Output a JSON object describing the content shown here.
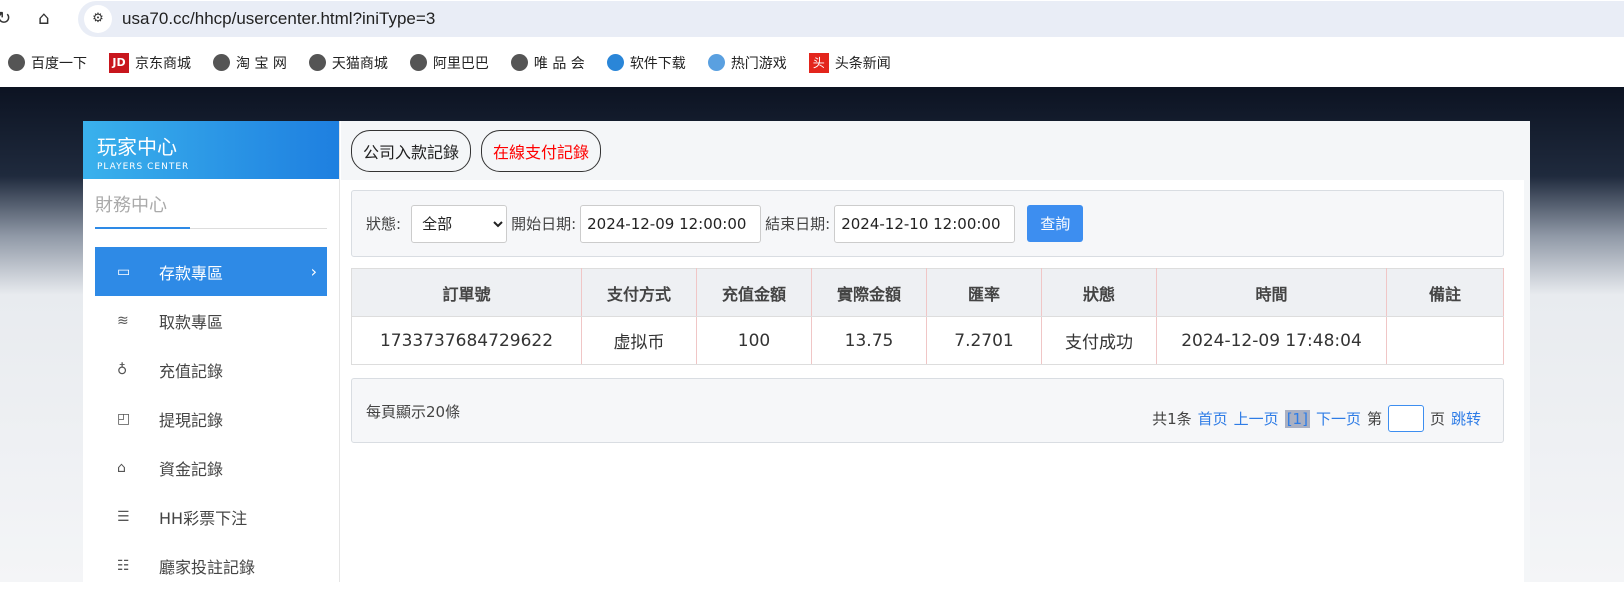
{
  "browser": {
    "url": "usa70.cc/hhcp/usercenter.html?iniType=3",
    "bookmarks": [
      {
        "label": "百度一下",
        "icon": "globe-icon"
      },
      {
        "label": "京东商城",
        "icon": "jd-icon"
      },
      {
        "label": "淘 宝 网",
        "icon": "globe-icon"
      },
      {
        "label": "天猫商城",
        "icon": "globe-icon"
      },
      {
        "label": "阿里巴巴",
        "icon": "globe-icon"
      },
      {
        "label": "唯 品 会",
        "icon": "globe-icon"
      },
      {
        "label": "软件下载",
        "icon": "download-icon"
      },
      {
        "label": "热门游戏",
        "icon": "game-icon"
      },
      {
        "label": "头条新闻",
        "icon": "toutiao-icon"
      }
    ]
  },
  "logo": {
    "title": "玩家中心",
    "subtitle": "PLAYERS CENTER",
    "jd_text": "JD",
    "tt_text": "头"
  },
  "sidebar": {
    "section": "財務中心",
    "items": [
      {
        "label": "存款專區",
        "active": true
      },
      {
        "label": "取款專區"
      },
      {
        "label": "充值記錄"
      },
      {
        "label": "提現記錄"
      },
      {
        "label": "資金記錄"
      },
      {
        "label": "HH彩票下注"
      },
      {
        "label": "廳家投註記錄"
      }
    ]
  },
  "tabs": [
    {
      "label": "公司入款記錄"
    },
    {
      "label": "在線支付記錄",
      "active": true
    }
  ],
  "filter": {
    "status_label": "狀態:",
    "status_value": "全部",
    "start_label": "開始日期:",
    "start_value": "2024-12-09 12:00:00",
    "end_label": "結束日期:",
    "end_value": "2024-12-10 12:00:00",
    "query": "查詢"
  },
  "table": {
    "headers": [
      "訂單號",
      "支付方式",
      "充值金額",
      "實際金額",
      "匯率",
      "狀態",
      "時間",
      "備註"
    ],
    "rows": [
      [
        "1733737684729622",
        "虚拟币",
        "100",
        "13.75",
        "7.2701",
        "支付成功",
        "2024-12-09 17:48:04",
        ""
      ]
    ]
  },
  "pager": {
    "per_page": "每頁顯示20條",
    "total": "共1条",
    "first": "首页",
    "prev": "上一页",
    "current": "[1]",
    "next": "下一页",
    "page_pre": "第",
    "page_post": "页",
    "jump": "跳转"
  },
  "colors": {
    "accent": "#2e8ae6",
    "active_tab": "#ff0000"
  }
}
